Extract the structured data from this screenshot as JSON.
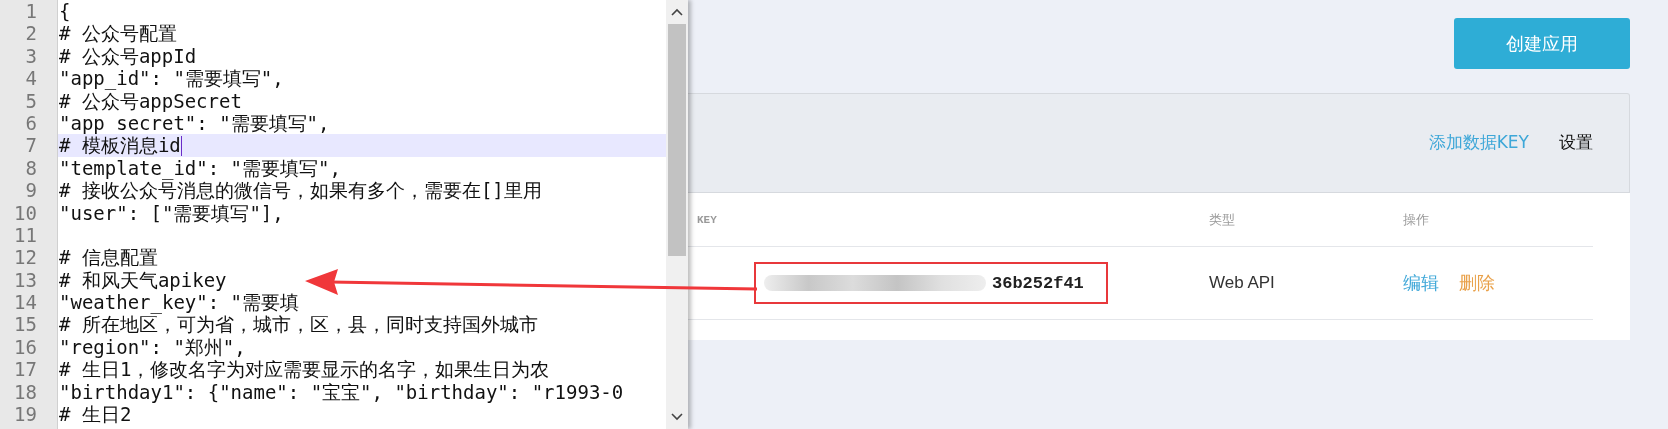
{
  "editor": {
    "lines": [
      {
        "number": "1",
        "text": "{",
        "current": false
      },
      {
        "number": "2",
        "text": "# 公众号配置",
        "current": false
      },
      {
        "number": "3",
        "text": "# 公众号appId",
        "current": false
      },
      {
        "number": "4",
        "text": "\"app_id\": \"需要填写\",",
        "current": false
      },
      {
        "number": "5",
        "text": "# 公众号appSecret",
        "current": false
      },
      {
        "number": "6",
        "text": "\"app_secret\": \"需要填写\",",
        "current": false
      },
      {
        "number": "7",
        "text": "# 模板消息id",
        "current": true
      },
      {
        "number": "8",
        "text": "\"template_id\": \"需要填写\",",
        "current": false
      },
      {
        "number": "9",
        "text": "# 接收公众号消息的微信号，如果有多个，需要在[]里用",
        "current": false
      },
      {
        "number": "10",
        "text": "\"user\": [\"需要填写\"],",
        "current": false
      },
      {
        "number": "11",
        "current": false
      },
      {
        "number": "12",
        "text": "# 信息配置",
        "current": false
      },
      {
        "number": "13",
        "text": "# 和风天气apikey",
        "current": false
      },
      {
        "number": "14",
        "text": "\"weather_key\": \"需要填",
        "current": false
      },
      {
        "number": "15",
        "text": "# 所在地区，可为省，城市，区，县，同时支持国外城市",
        "current": false
      },
      {
        "number": "16",
        "text": "\"region\": \"郑州\",",
        "current": false
      },
      {
        "number": "17",
        "text": "# 生日1，修改名字为对应需要显示的名字，如果生日为农",
        "current": false
      },
      {
        "number": "18",
        "text": "\"birthday1\": {\"name\": \"宝宝\", \"birthday\": \"r1993-0",
        "current": false
      },
      {
        "number": "19",
        "text": "# 生日2",
        "current": false
      }
    ]
  },
  "create_button": "创建应用",
  "panel": {
    "actions": [
      {
        "label": "添加数据KEY",
        "kind": "link"
      },
      {
        "label": "设置",
        "kind": "plain"
      }
    ],
    "table": {
      "columns": [
        "KEY",
        "类型",
        "操作"
      ],
      "rows": [
        {
          "key_visible": "36b252f41",
          "key_redacted": true,
          "highlighted": true,
          "type": "Web API",
          "actions": [
            {
              "label": "编辑",
              "kind": "edit"
            },
            {
              "label": "删除",
              "kind": "delete"
            }
          ]
        }
      ]
    }
  }
}
